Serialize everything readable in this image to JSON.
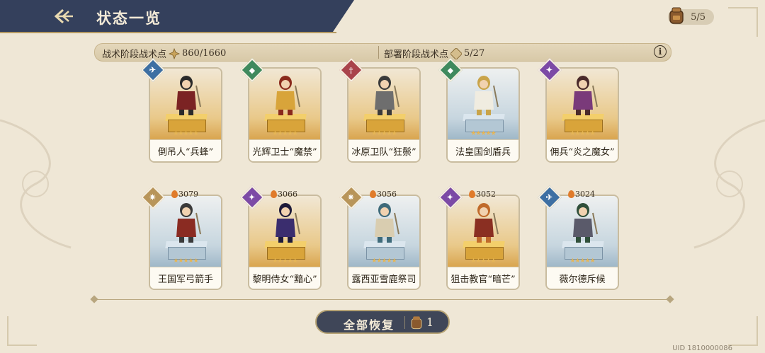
{
  "header": {
    "title": "状态一览",
    "stamina": "5/5"
  },
  "points": {
    "tactical_label": "战术阶段战术点",
    "tactical_value": "860/1660",
    "deploy_label": "部署阶段战术点",
    "deploy_value": "5/27",
    "info_icon": "i"
  },
  "units_row1": [
    {
      "name": "倒吊人“兵蜂”",
      "power": "",
      "badge": "blue-b",
      "tint": "gold",
      "badge_icon": "wing-icon"
    },
    {
      "name": "光辉卫士“魔禁”",
      "power": "",
      "badge": "green-b",
      "tint": "gold",
      "badge_icon": "shield-icon"
    },
    {
      "name": "冰原卫队“狂鬃”",
      "power": "",
      "badge": "red-b",
      "tint": "gold",
      "badge_icon": "sword-icon"
    },
    {
      "name": "法皇国剑盾兵",
      "power": "",
      "badge": "green-b",
      "tint": "blue",
      "badge_icon": "shield-icon"
    },
    {
      "name": "佣兵“炎之魔女”",
      "power": "",
      "badge": "purple-b",
      "tint": "gold",
      "badge_icon": "magic-icon"
    }
  ],
  "units_row2": [
    {
      "name": "王国军弓箭手",
      "power": "3079",
      "badge": "gold-b",
      "tint": "blue",
      "badge_icon": "bow-icon"
    },
    {
      "name": "黎明侍女“黯心”",
      "power": "3066",
      "badge": "purple-b",
      "tint": "gold",
      "badge_icon": "magic-icon"
    },
    {
      "name": "露西亚雪鹿祭司",
      "power": "3056",
      "badge": "gold-b",
      "tint": "blue",
      "badge_icon": "bow-icon"
    },
    {
      "name": "狙击教官“暗芒”",
      "power": "3052",
      "badge": "purple-b",
      "tint": "gold",
      "badge_icon": "magic-icon"
    },
    {
      "name": "薇尔德斥候",
      "power": "3024",
      "badge": "blue-b",
      "tint": "blue",
      "badge_icon": "wing-icon"
    }
  ],
  "stars": "★★★★★",
  "footer": {
    "restore_label": "全部恢复",
    "restore_count": "1",
    "uid": "UID 1810000086"
  },
  "colors": {
    "header_bg": "#34405c",
    "accent_gold": "#b59a63",
    "page_bg": "#efe7d6"
  }
}
